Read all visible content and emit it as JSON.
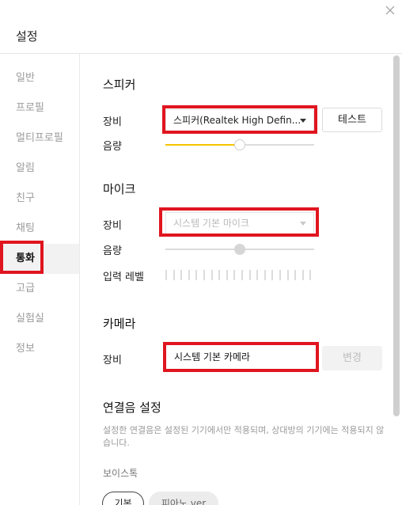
{
  "window": {
    "title": "설정"
  },
  "sidebar": {
    "items": [
      {
        "label": "일반"
      },
      {
        "label": "프로필"
      },
      {
        "label": "멀티프로필"
      },
      {
        "label": "알림"
      },
      {
        "label": "친구"
      },
      {
        "label": "채팅"
      },
      {
        "label": "통화",
        "active": true
      },
      {
        "label": "고급"
      },
      {
        "label": "실험실"
      },
      {
        "label": "정보"
      }
    ]
  },
  "speaker": {
    "title": "스피커",
    "device_label": "장비",
    "device_value": "스피커(Realtek High Defin...",
    "test_button": "테스트",
    "volume_label": "음량",
    "volume_level": 0.5
  },
  "mic": {
    "title": "마이크",
    "device_label": "장비",
    "device_value": "시스템 기본 마이크",
    "volume_label": "음량",
    "volume_level": 0.5,
    "input_level_label": "입력 레벨"
  },
  "camera": {
    "title": "카메라",
    "device_label": "장비",
    "device_value": "시스템 기본 카메라",
    "change_button": "변경"
  },
  "ringtone": {
    "title": "연결음 설정",
    "note": "설정한 연결음은 설정된 기기에서만 적용되며, 상대방의 기기에는 적용되지 않습니다.",
    "voice_label": "보이스톡",
    "options": [
      {
        "label": "기본"
      },
      {
        "label": "피아노 ver"
      }
    ]
  },
  "colors": {
    "highlight": "#e0151f",
    "accent": "#f5c400"
  }
}
